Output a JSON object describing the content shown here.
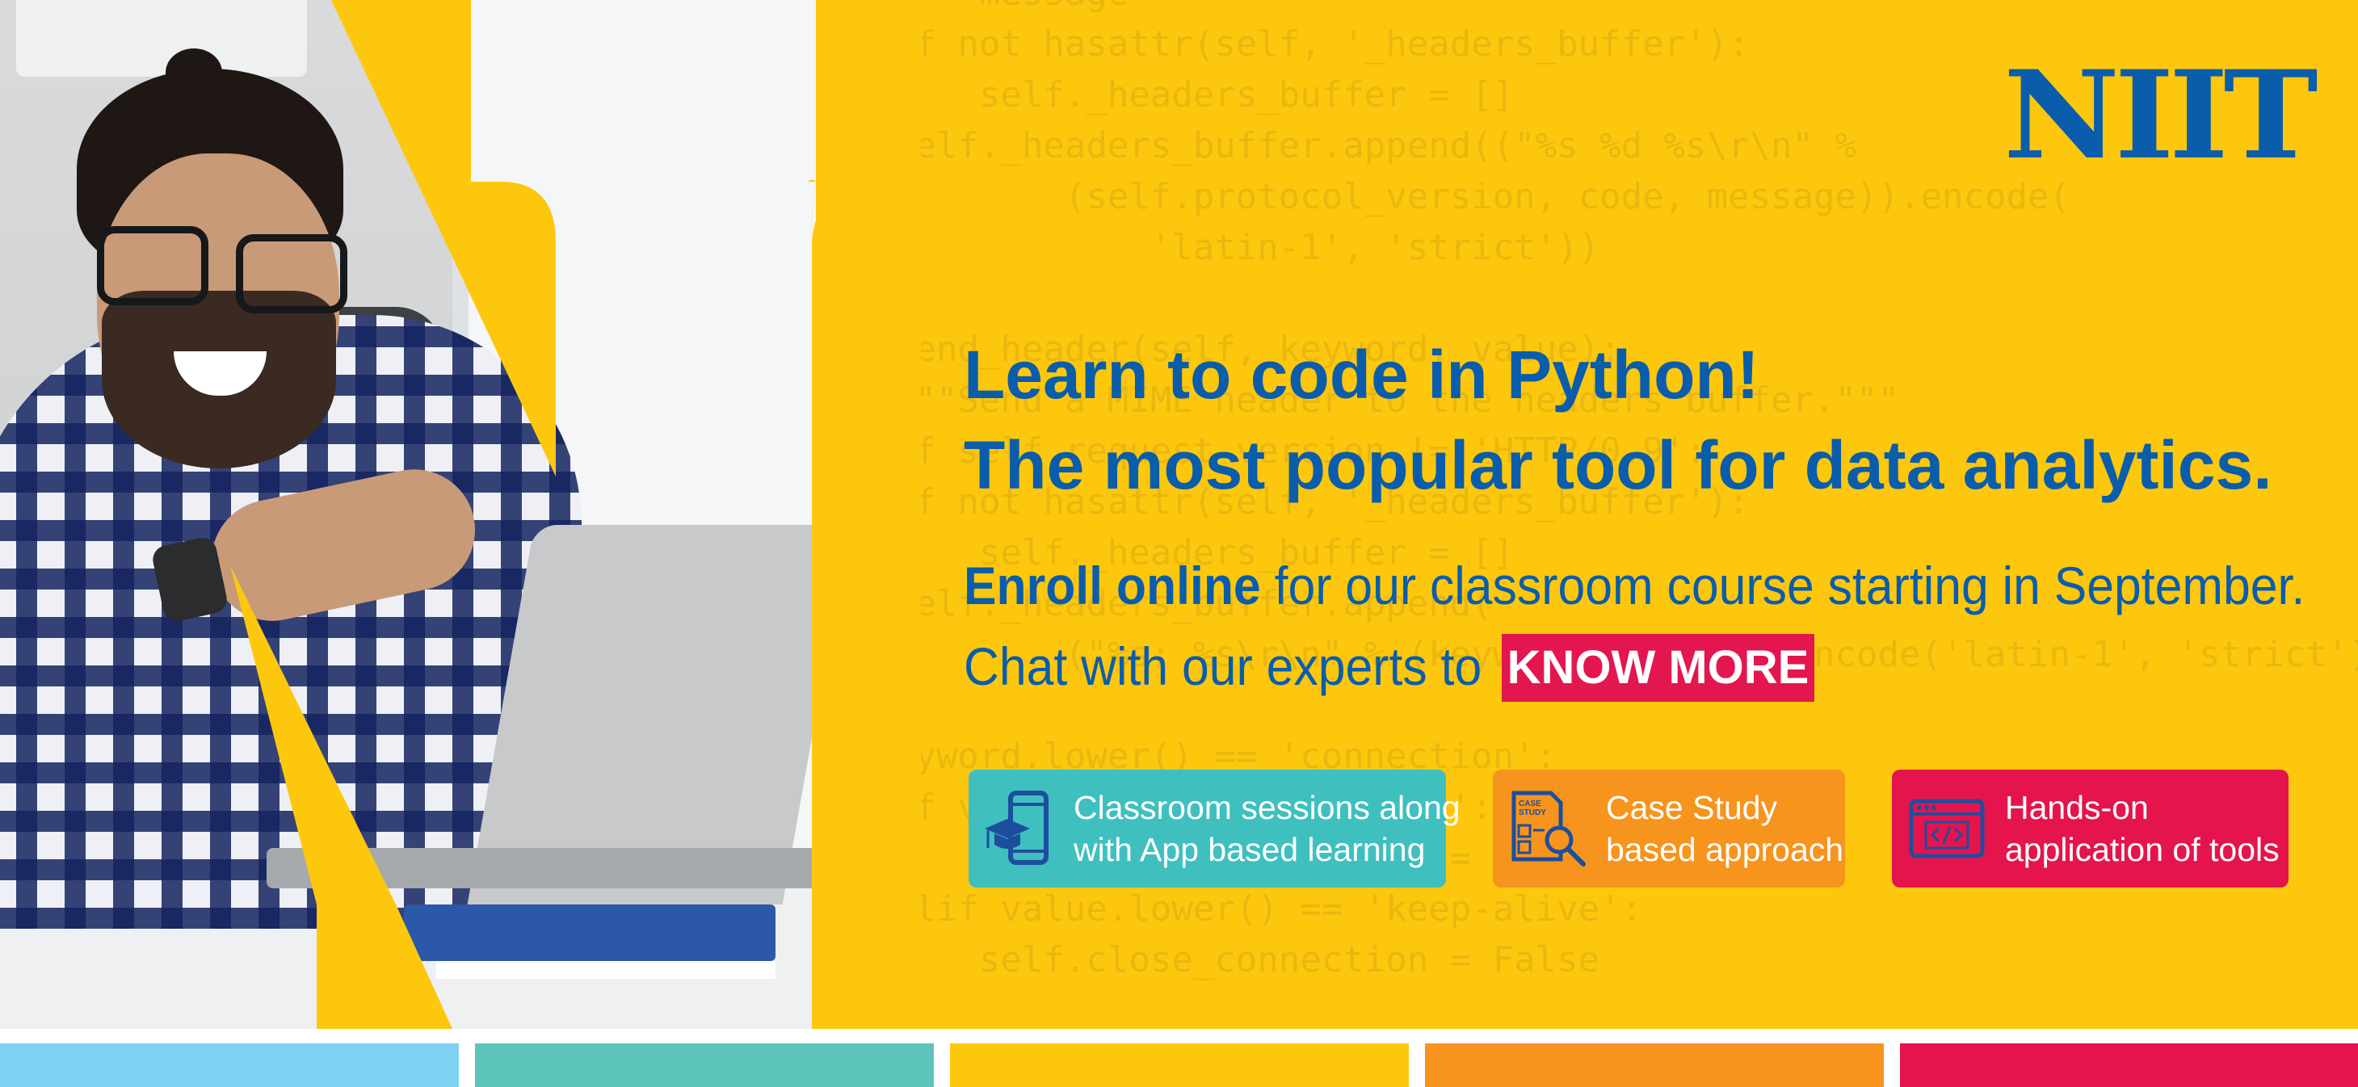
{
  "brand": {
    "logo_text": "NIIT",
    "colors": {
      "yellow": "#fdc70e",
      "blue": "#0a5dab",
      "teal": "#3fc0bf",
      "orange": "#f7941d",
      "red": "#e6144d",
      "light_blue": "#7fd1f2"
    }
  },
  "headline": {
    "line1": "Learn to code in Python!",
    "line2": "The most popular tool for data analytics."
  },
  "enroll": {
    "bold": "Enroll online",
    "rest": " for our classroom course starting in September."
  },
  "chat": {
    "text": "Chat with our experts to",
    "button_label": "KNOW MORE"
  },
  "features": [
    {
      "icon": "mobile-graduation-icon",
      "text": "Classroom sessions along\nwith App based learning"
    },
    {
      "icon": "case-study-search-icon",
      "text": "Case Study\nbased approach",
      "icon_label": "CASE\nSTUDY"
    },
    {
      "icon": "code-window-icon",
      "text": "Hands-on\napplication of tools"
    }
  ],
  "background_code": "        message =\n    if not hasattr(self, '_headers_buffer'):\n        self._headers_buffer = []\n    self._headers_buffer.append((\"%s %d %s\\r\\n\" %\n            (self.protocol_version, code, message)).encode(\n                'latin-1', 'strict'))\n\ndef send_header(self, keyword, value):\n    \"\"\"Send a MIME header to the headers buffer.\"\"\"\n    if self.request_version != 'HTTP/0.9':\n    if not hasattr(self, '_headers_buffer'):\n        self._headers_buffer = []\n    self._headers_buffer.append(\n            (\"%s: %s\\r\\n\" % (keyword, value)).encode('latin-1', 'strict'))\n\nif keyword.lower() == 'connection':\n    if value.lower() == 'close':\n        self.close_connection = True\n    elif value.lower() == 'keep-alive':\n        self.close_connection = False"
}
